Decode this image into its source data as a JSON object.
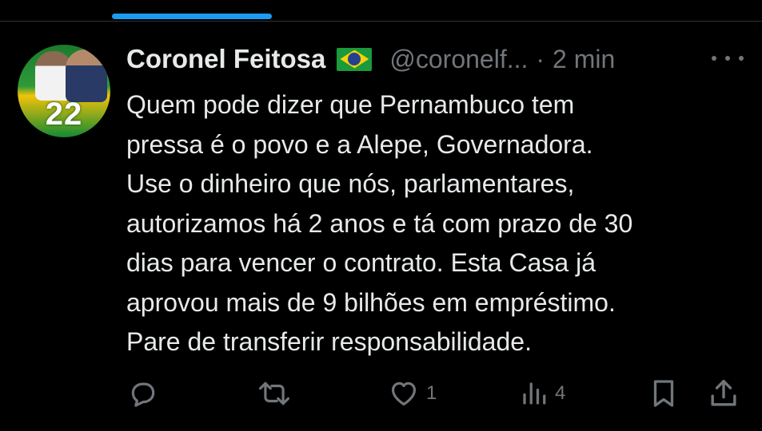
{
  "tweet": {
    "author_name": "Coronel Feitosa",
    "author_handle": "@coronelf...",
    "separator": "·",
    "time": "2 min",
    "avatar_number": "22",
    "text_lines": [
      "Quem pode dizer que Pernambuco tem",
      "pressa é o povo e a Alepe, Governadora.",
      "Use o dinheiro que nós, parlamentares,",
      "autorizamos há 2 anos e tá com prazo de 30",
      "dias para vencer o contrato. Esta Casa já",
      "aprovou mais de 9 bilhões em empréstimo.",
      "Pare de transferir responsabilidade."
    ],
    "likes": "1",
    "views": "4"
  },
  "icons": {
    "reply": "reply-icon",
    "retweet": "retweet-icon",
    "like": "heart-icon",
    "views": "views-icon",
    "bookmark": "bookmark-icon",
    "share": "share-icon",
    "more": "more-icon",
    "flag": "brazil-flag-icon"
  },
  "colors": {
    "background": "#000000",
    "text": "#e7e9ea",
    "muted": "#71767b",
    "accent": "#1d9bf0"
  }
}
